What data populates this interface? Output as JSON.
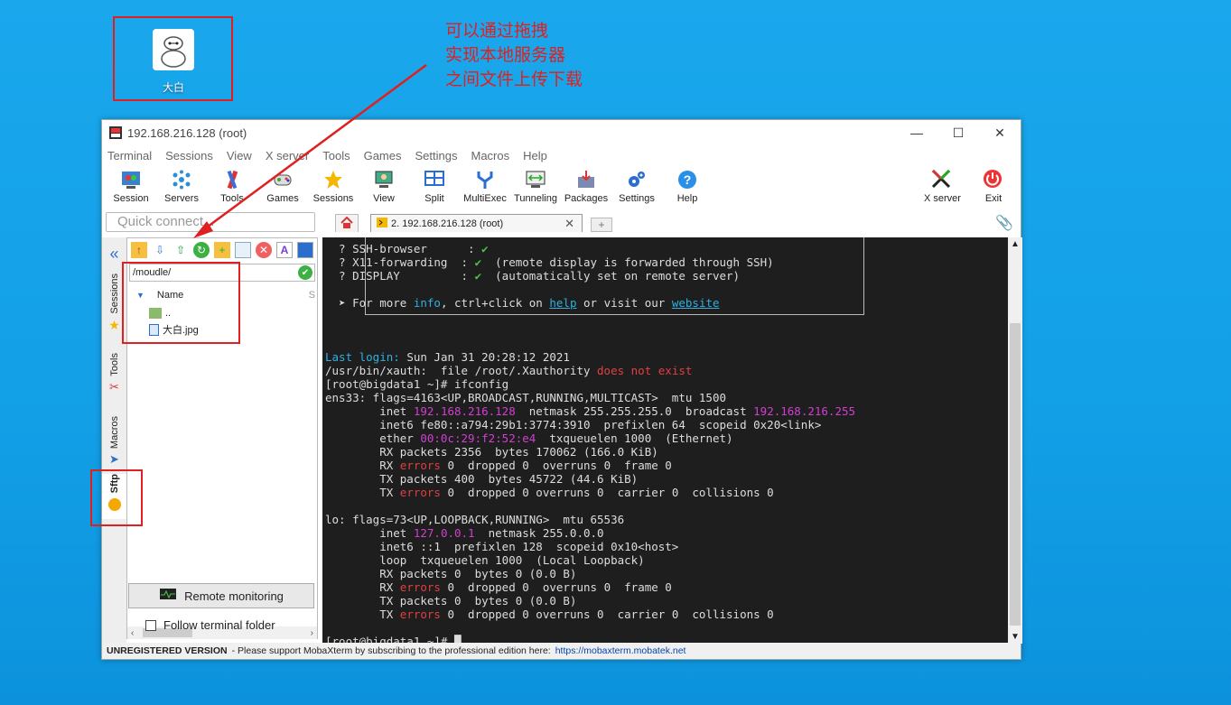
{
  "desktop": {
    "icon_label": "大白",
    "annotation": [
      "可以通过拖拽",
      "实现本地服务器",
      "之间文件上传下载"
    ]
  },
  "window": {
    "title": "192.168.216.128 (root)",
    "menu": [
      "Terminal",
      "Sessions",
      "View",
      "X server",
      "Tools",
      "Games",
      "Settings",
      "Macros",
      "Help"
    ],
    "toolbar": [
      {
        "label": "Session",
        "icon": "session-icon"
      },
      {
        "label": "Servers",
        "icon": "servers-icon"
      },
      {
        "label": "Tools",
        "icon": "tools-icon"
      },
      {
        "label": "Games",
        "icon": "games-icon"
      },
      {
        "label": "Sessions",
        "icon": "sessions-star-icon"
      },
      {
        "label": "View",
        "icon": "view-icon"
      },
      {
        "label": "Split",
        "icon": "split-icon"
      },
      {
        "label": "MultiExec",
        "icon": "multiexec-icon"
      },
      {
        "label": "Tunneling",
        "icon": "tunneling-icon"
      },
      {
        "label": "Packages",
        "icon": "packages-icon"
      },
      {
        "label": "Settings",
        "icon": "settings-icon"
      },
      {
        "label": "Help",
        "icon": "help-icon"
      }
    ],
    "xserver_label": "X server",
    "exit_label": "Exit"
  },
  "tabs": {
    "quick_connect_placeholder": "Quick connect...",
    "session_tab": "2. 192.168.216.128 (root)"
  },
  "side_tabs": [
    "Sessions",
    "Tools",
    "Macros",
    "Sftp"
  ],
  "sftp": {
    "path": "/moudle/",
    "column_name": "Name",
    "files": [
      {
        "name": "..",
        "icon": "folder-up-icon"
      },
      {
        "name": "大白.jpg",
        "icon": "image-file-icon"
      }
    ],
    "remote_monitoring": "Remote monitoring",
    "follow_terminal": "Follow terminal folder"
  },
  "terminal": {
    "colors": {
      "fg": "#dddddd",
      "magenta": "#d040d0",
      "red": "#e04040",
      "cyan": "#30b0e0",
      "green": "#50c050",
      "bg": "#1e1e1e"
    },
    "lines": [
      [
        [
          "  ? SSH-browser      : ",
          "fg"
        ],
        [
          "✔",
          "green"
        ]
      ],
      [
        [
          "  ? X11-forwarding  : ",
          "fg"
        ],
        [
          "✔",
          "green"
        ],
        [
          "  (remote display is forwarded through SSH)",
          "fg"
        ]
      ],
      [
        [
          "  ? DISPLAY         : ",
          "fg"
        ],
        [
          "✔",
          "green"
        ],
        [
          "  (automatically set on remote server)",
          "fg"
        ]
      ],
      [
        [
          "",
          "fg"
        ]
      ],
      [
        [
          "  ➤ For more ",
          "fg"
        ],
        [
          "info",
          "cyan"
        ],
        [
          ", ctrl+click on ",
          "fg"
        ],
        [
          "help",
          "link"
        ],
        [
          " or visit our ",
          "fg"
        ],
        [
          "website",
          "link"
        ]
      ],
      [
        [
          "",
          "fg"
        ]
      ],
      [
        [
          "",
          "fg"
        ]
      ],
      [
        [
          "",
          "fg"
        ]
      ],
      [
        [
          "Last login:",
          "cyan"
        ],
        [
          " Sun Jan 31 20:28:12 2021",
          "fg"
        ]
      ],
      [
        [
          "/usr/bin/xauth:  file /root/.Xauthority ",
          "fg"
        ],
        [
          "does not exist",
          "red"
        ]
      ],
      [
        [
          "[root@bigdata1 ~]# ifconfig",
          "fg"
        ]
      ],
      [
        [
          "ens33: flags=4163<UP,BROADCAST,RUNNING,MULTICAST>  mtu 1500",
          "fg"
        ]
      ],
      [
        [
          "        inet ",
          "fg"
        ],
        [
          "192.168.216.128",
          "magenta"
        ],
        [
          "  netmask 255.255.255.0  broadcast ",
          "fg"
        ],
        [
          "192.168.216.255",
          "magenta"
        ]
      ],
      [
        [
          "        inet6 fe80::a794:29b1:3774:3910  prefixlen 64  scopeid 0x20<link>",
          "fg"
        ]
      ],
      [
        [
          "        ether ",
          "fg"
        ],
        [
          "00:0c:29:f2:52:e4",
          "magenta"
        ],
        [
          "  txqueuelen 1000  (Ethernet)",
          "fg"
        ]
      ],
      [
        [
          "        RX packets 2356  bytes 170062 (166.0 KiB)",
          "fg"
        ]
      ],
      [
        [
          "        RX ",
          "fg"
        ],
        [
          "errors",
          "red"
        ],
        [
          " 0  dropped 0  overruns 0  frame 0",
          "fg"
        ]
      ],
      [
        [
          "        TX packets 400  bytes 45722 (44.6 KiB)",
          "fg"
        ]
      ],
      [
        [
          "        TX ",
          "fg"
        ],
        [
          "errors",
          "red"
        ],
        [
          " 0  dropped 0 overruns 0  carrier 0  collisions 0",
          "fg"
        ]
      ],
      [
        [
          "",
          "fg"
        ]
      ],
      [
        [
          "lo: flags=73<UP,LOOPBACK,RUNNING>  mtu 65536",
          "fg"
        ]
      ],
      [
        [
          "        inet ",
          "fg"
        ],
        [
          "127.0.0.1",
          "magenta"
        ],
        [
          "  netmask 255.0.0.0",
          "fg"
        ]
      ],
      [
        [
          "        inet6 ::1  prefixlen 128  scopeid 0x10<host>",
          "fg"
        ]
      ],
      [
        [
          "        loop  txqueuelen 1000  (Local Loopback)",
          "fg"
        ]
      ],
      [
        [
          "        RX packets 0  bytes 0 (0.0 B)",
          "fg"
        ]
      ],
      [
        [
          "        RX ",
          "fg"
        ],
        [
          "errors",
          "red"
        ],
        [
          " 0  dropped 0  overruns 0  frame 0",
          "fg"
        ]
      ],
      [
        [
          "        TX packets 0  bytes 0 (0.0 B)",
          "fg"
        ]
      ],
      [
        [
          "        TX ",
          "fg"
        ],
        [
          "errors",
          "red"
        ],
        [
          " 0  dropped 0 overruns 0  carrier 0  collisions 0",
          "fg"
        ]
      ],
      [
        [
          "",
          "fg"
        ]
      ],
      [
        [
          "[root@bigdata1 ~]# ",
          "fg"
        ],
        [
          "█",
          "fg"
        ]
      ]
    ]
  },
  "status": {
    "unregistered": "UNREGISTERED VERSION",
    "message": "-  Please support MobaXterm by subscribing to the professional edition here:",
    "link": "https://mobaxterm.mobatek.net"
  }
}
